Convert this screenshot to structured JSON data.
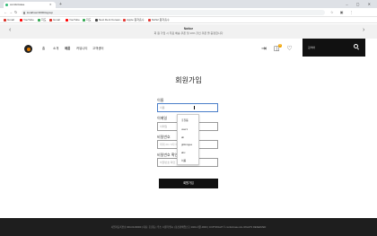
{
  "browser": {
    "tab_title": "comfortcase",
    "tab_close": "✕",
    "new_tab": "+",
    "window_controls": "– ▢ ✕",
    "url": "localhost:3000/signup",
    "nav_back": "←",
    "nav_forward": "→",
    "nav_reload": "↻",
    "toolbar_icons": "☆ ▣ ⋮",
    "bookmarks": [
      {
        "label": "Gmail",
        "color": "#d93025"
      },
      {
        "label": "YouTube",
        "color": "#ff0000"
      },
      {
        "label": "지도",
        "color": "#34a853"
      },
      {
        "label": "Gmail",
        "color": "#d93025"
      },
      {
        "label": "YouTube",
        "color": "#ff0000"
      },
      {
        "label": "지도",
        "color": "#34a853"
      },
      {
        "label": "Next Dent Korean...",
        "color": "#444444"
      },
      {
        "label": "Apple 원자흡수",
        "color": "#e53935"
      },
      {
        "label": "NAS2 원자흡수",
        "color": "#e53935"
      }
    ]
  },
  "notice": {
    "title": "Notice",
    "text": "회 원 가입 시 무료 배송 쿠폰 및 10% 할인 쿠폰 을 증정합니다",
    "prev": "‹",
    "next": "›"
  },
  "header": {
    "nav": [
      "홈",
      "소개",
      "제품",
      "커뮤니티",
      "고객센터"
    ],
    "icons": "⇥ ◫ ♡",
    "cart_count": "0",
    "search_placeholder": "검색어"
  },
  "form": {
    "title": "회원가입",
    "fields": [
      {
        "label": "이름",
        "placeholder": "이름"
      },
      {
        "label": "이메일",
        "placeholder": "이메일"
      },
      {
        "label": "비밀번호",
        "placeholder": "최대 20 / 6자 이상"
      },
      {
        "label": "비밀번호 확인",
        "placeholder": "비밀번호 확인"
      }
    ],
    "autocomplete": [
      "홍길동",
      "user1",
      "ab",
      "gildongee",
      "abc",
      "이름"
    ],
    "submit_label": "회원가입"
  },
  "footer": {
    "text": "사업자등록번호 000-00-00000 | 대표: 홍길동 | 주소: 서울특별시 | 통신판매업신고 2023-서울-0000 | COPYRIGHT © comfortcase ALL RIGHTS RESERVED"
  },
  "colors": {
    "accent": "#e07b00",
    "badge": "#f2a400",
    "focus": "#4a7ec9",
    "dark": "#111111"
  }
}
